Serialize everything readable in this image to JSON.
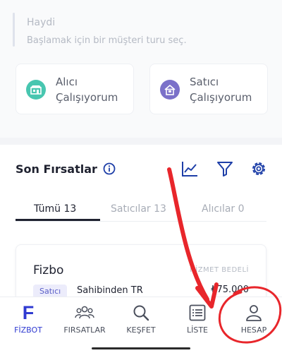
{
  "intro": {
    "greeting": "Haydi",
    "subtitle": "Başlamak için bir müşteri turu seç."
  },
  "roles": {
    "buyer": {
      "line1": "Alıcı",
      "line2": "Çalışıyorum",
      "icon": "store-icon",
      "color": "#48c6b0"
    },
    "seller": {
      "line1": "Satıcı",
      "line2": "Çalışıyorum",
      "icon": "house-icon",
      "color": "#7b71c9"
    }
  },
  "section": {
    "title": "Son Fırsatlar",
    "icons": [
      "info-icon",
      "chart-icon",
      "filter-icon",
      "settings-icon"
    ]
  },
  "tabs": [
    {
      "label": "Tümü 13",
      "active": true
    },
    {
      "label": "Satıcılar 13",
      "active": false
    },
    {
      "label": "Alıcılar 0",
      "active": false
    }
  ],
  "opportunity": {
    "title": "Fizbo",
    "fee_label": "HİZMET BEDELİ",
    "badge": "Satıcı",
    "source": "Sahibinden TR",
    "price": "₺75.000"
  },
  "nav": {
    "items": [
      {
        "label": "FİZBOT",
        "icon": "fizbot-logo",
        "active": true,
        "logo_text": "F"
      },
      {
        "label": "FIRSATLAR",
        "icon": "people-icon",
        "active": false
      },
      {
        "label": "KEŞFET",
        "icon": "search-icon",
        "active": false
      },
      {
        "label": "LİSTE",
        "icon": "list-icon",
        "active": false
      },
      {
        "label": "HESAP",
        "icon": "person-icon",
        "active": false
      }
    ]
  },
  "colors": {
    "accent": "#2f3ad1",
    "annotation": "#e8262b"
  }
}
